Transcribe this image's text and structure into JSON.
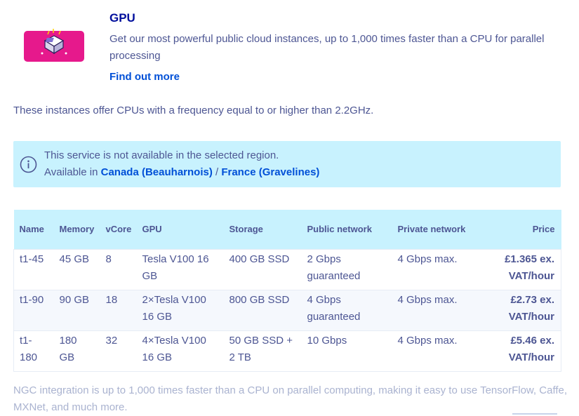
{
  "header": {
    "title": "GPU",
    "description": "Get our most powerful public cloud instances, up to 1,000 times faster than a CPU for parallel processing",
    "link_label": "Find out more",
    "icon": "gpu-chip-icon"
  },
  "intro_text": "These instances offer CPUs with a frequency equal to or higher than 2.2GHz.",
  "notice": {
    "icon": "info-icon",
    "line1": "This service is not available in the selected region.",
    "available_prefix": "Available in ",
    "region1": "Canada (Beauharnois)",
    "separator": " / ",
    "region2": "France (Gravelines)"
  },
  "table": {
    "headers": {
      "name": "Name",
      "memory": "Memory",
      "vcore": "vCore",
      "gpu": "GPU",
      "storage": "Storage",
      "public_network": "Public network",
      "private_network": "Private network",
      "price": "Price"
    },
    "rows": [
      {
        "name": "t1-45",
        "memory": "45 GB",
        "vcore": "8",
        "gpu": "Tesla V100 16 GB",
        "storage": "400 GB SSD",
        "public_network": "2 Gbps guaranteed",
        "private_network": "4 Gbps max.",
        "price": "£1.365 ex. VAT/hour"
      },
      {
        "name": "t1-90",
        "memory": "90 GB",
        "vcore": "18",
        "gpu": "2×Tesla V100 16 GB",
        "storage": "800 GB SSD",
        "public_network": "4 Gbps guaranteed",
        "private_network": "4 Gbps max.",
        "price": "£2.73 ex. VAT/hour"
      },
      {
        "name": "t1-180",
        "memory": "180 GB",
        "vcore": "32",
        "gpu": "4×Tesla V100 16 GB",
        "storage": "50 GB SSD + 2 TB",
        "public_network": "10 Gbps",
        "private_network": "4 Gbps max.",
        "price": "£5.46 ex. VAT/hour"
      }
    ]
  },
  "footer_text": "NGC integration is up to 1,000 times faster than a CPU on parallel computing, making it easy to use TensorFlow, Caffe, MXNet, and much more.",
  "colors": {
    "title": "#000e9c",
    "link": "#0050d7",
    "text": "#4d5693",
    "notice_bg": "#c8f2fe",
    "muted": "#aab3d0"
  }
}
